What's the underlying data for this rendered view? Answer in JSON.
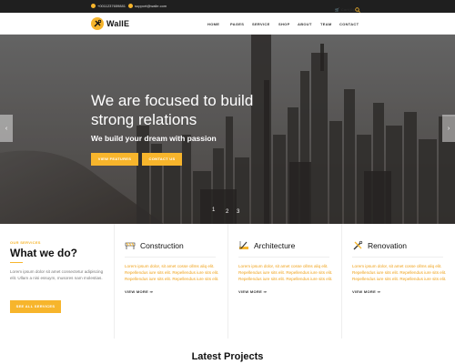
{
  "topbar": {
    "phone": "+0011237659881",
    "email": "support@walle.com",
    "cart": "Cart(0)"
  },
  "header": {
    "logo_text": "WallE",
    "nav": [
      "HOME",
      "PAGES",
      "SERVICE",
      "SHOP",
      "ABOUT",
      "TEAM",
      "CONTACT"
    ]
  },
  "hero": {
    "title": "We are focused to build strong relations",
    "subtitle": "We build your dream with passion",
    "btn_features": "VIEW FEATURES",
    "btn_contact": "CONTACT US",
    "slides": [
      "1",
      "2",
      "3"
    ],
    "prev_icon": "chevron-left-icon",
    "next_icon": "chevron-right-icon"
  },
  "services": {
    "eyebrow": "OUR SERVICES",
    "heading": "What we do?",
    "intro": "Lorem ipsum dolor sit amet consectetur adipiscing elit. Ullam a nisi essuym, musores nam molestias.",
    "button": "SEE ALL SERVICES",
    "cards": [
      {
        "title": "Construction",
        "icon": "barrier-icon",
        "text": "Lorem ipsum dolor, sit amet cosse ollms aliq elit. Repellendus iure sits elit. Repellendus iure sits elit. Repellendus iure sits elit. Repellendus iure sits elit.",
        "link": "VIEW MORE ⇒"
      },
      {
        "title": "Architecture",
        "icon": "ruler-pencil-icon",
        "text": "Lorem ipsum dolor, sit amet cosse ollms aliq elit. Repellendus iure sits elit. Repellendus iure sits elit. Repellendus iure sits elit. Repellendus iure sits elit.",
        "link": "VIEW MORE ⇒"
      },
      {
        "title": "Renovation",
        "icon": "tools-icon",
        "text": "Lorem ipsum dolor, sit amet cosse ollms aliq elit. Repellendus iure sits elit. Repellendus iure sits elit. Repellendus iure sits elit. Repellendus iure sits elit.",
        "link": "VIEW MORE ⇒"
      }
    ]
  },
  "latest": {
    "heading": "Latest Projects"
  },
  "colors": {
    "accent": "#f7b52c",
    "topbar": "#1f1f1f",
    "text_dark": "#111111"
  }
}
